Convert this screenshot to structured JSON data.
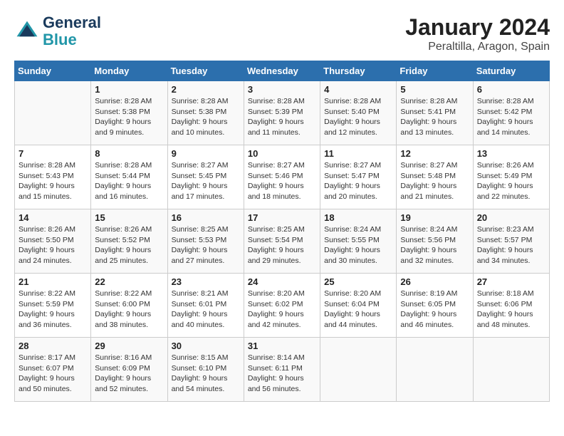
{
  "logo": {
    "line1": "General",
    "line2": "Blue"
  },
  "title": "January 2024",
  "location": "Peraltilla, Aragon, Spain",
  "days_of_week": [
    "Sunday",
    "Monday",
    "Tuesday",
    "Wednesday",
    "Thursday",
    "Friday",
    "Saturday"
  ],
  "weeks": [
    [
      {
        "day": "",
        "info": ""
      },
      {
        "day": "1",
        "info": "Sunrise: 8:28 AM\nSunset: 5:38 PM\nDaylight: 9 hours\nand 9 minutes."
      },
      {
        "day": "2",
        "info": "Sunrise: 8:28 AM\nSunset: 5:38 PM\nDaylight: 9 hours\nand 10 minutes."
      },
      {
        "day": "3",
        "info": "Sunrise: 8:28 AM\nSunset: 5:39 PM\nDaylight: 9 hours\nand 11 minutes."
      },
      {
        "day": "4",
        "info": "Sunrise: 8:28 AM\nSunset: 5:40 PM\nDaylight: 9 hours\nand 12 minutes."
      },
      {
        "day": "5",
        "info": "Sunrise: 8:28 AM\nSunset: 5:41 PM\nDaylight: 9 hours\nand 13 minutes."
      },
      {
        "day": "6",
        "info": "Sunrise: 8:28 AM\nSunset: 5:42 PM\nDaylight: 9 hours\nand 14 minutes."
      }
    ],
    [
      {
        "day": "7",
        "info": "Sunrise: 8:28 AM\nSunset: 5:43 PM\nDaylight: 9 hours\nand 15 minutes."
      },
      {
        "day": "8",
        "info": "Sunrise: 8:28 AM\nSunset: 5:44 PM\nDaylight: 9 hours\nand 16 minutes."
      },
      {
        "day": "9",
        "info": "Sunrise: 8:27 AM\nSunset: 5:45 PM\nDaylight: 9 hours\nand 17 minutes."
      },
      {
        "day": "10",
        "info": "Sunrise: 8:27 AM\nSunset: 5:46 PM\nDaylight: 9 hours\nand 18 minutes."
      },
      {
        "day": "11",
        "info": "Sunrise: 8:27 AM\nSunset: 5:47 PM\nDaylight: 9 hours\nand 20 minutes."
      },
      {
        "day": "12",
        "info": "Sunrise: 8:27 AM\nSunset: 5:48 PM\nDaylight: 9 hours\nand 21 minutes."
      },
      {
        "day": "13",
        "info": "Sunrise: 8:26 AM\nSunset: 5:49 PM\nDaylight: 9 hours\nand 22 minutes."
      }
    ],
    [
      {
        "day": "14",
        "info": "Sunrise: 8:26 AM\nSunset: 5:50 PM\nDaylight: 9 hours\nand 24 minutes."
      },
      {
        "day": "15",
        "info": "Sunrise: 8:26 AM\nSunset: 5:52 PM\nDaylight: 9 hours\nand 25 minutes."
      },
      {
        "day": "16",
        "info": "Sunrise: 8:25 AM\nSunset: 5:53 PM\nDaylight: 9 hours\nand 27 minutes."
      },
      {
        "day": "17",
        "info": "Sunrise: 8:25 AM\nSunset: 5:54 PM\nDaylight: 9 hours\nand 29 minutes."
      },
      {
        "day": "18",
        "info": "Sunrise: 8:24 AM\nSunset: 5:55 PM\nDaylight: 9 hours\nand 30 minutes."
      },
      {
        "day": "19",
        "info": "Sunrise: 8:24 AM\nSunset: 5:56 PM\nDaylight: 9 hours\nand 32 minutes."
      },
      {
        "day": "20",
        "info": "Sunrise: 8:23 AM\nSunset: 5:57 PM\nDaylight: 9 hours\nand 34 minutes."
      }
    ],
    [
      {
        "day": "21",
        "info": "Sunrise: 8:22 AM\nSunset: 5:59 PM\nDaylight: 9 hours\nand 36 minutes."
      },
      {
        "day": "22",
        "info": "Sunrise: 8:22 AM\nSunset: 6:00 PM\nDaylight: 9 hours\nand 38 minutes."
      },
      {
        "day": "23",
        "info": "Sunrise: 8:21 AM\nSunset: 6:01 PM\nDaylight: 9 hours\nand 40 minutes."
      },
      {
        "day": "24",
        "info": "Sunrise: 8:20 AM\nSunset: 6:02 PM\nDaylight: 9 hours\nand 42 minutes."
      },
      {
        "day": "25",
        "info": "Sunrise: 8:20 AM\nSunset: 6:04 PM\nDaylight: 9 hours\nand 44 minutes."
      },
      {
        "day": "26",
        "info": "Sunrise: 8:19 AM\nSunset: 6:05 PM\nDaylight: 9 hours\nand 46 minutes."
      },
      {
        "day": "27",
        "info": "Sunrise: 8:18 AM\nSunset: 6:06 PM\nDaylight: 9 hours\nand 48 minutes."
      }
    ],
    [
      {
        "day": "28",
        "info": "Sunrise: 8:17 AM\nSunset: 6:07 PM\nDaylight: 9 hours\nand 50 minutes."
      },
      {
        "day": "29",
        "info": "Sunrise: 8:16 AM\nSunset: 6:09 PM\nDaylight: 9 hours\nand 52 minutes."
      },
      {
        "day": "30",
        "info": "Sunrise: 8:15 AM\nSunset: 6:10 PM\nDaylight: 9 hours\nand 54 minutes."
      },
      {
        "day": "31",
        "info": "Sunrise: 8:14 AM\nSunset: 6:11 PM\nDaylight: 9 hours\nand 56 minutes."
      },
      {
        "day": "",
        "info": ""
      },
      {
        "day": "",
        "info": ""
      },
      {
        "day": "",
        "info": ""
      }
    ]
  ]
}
